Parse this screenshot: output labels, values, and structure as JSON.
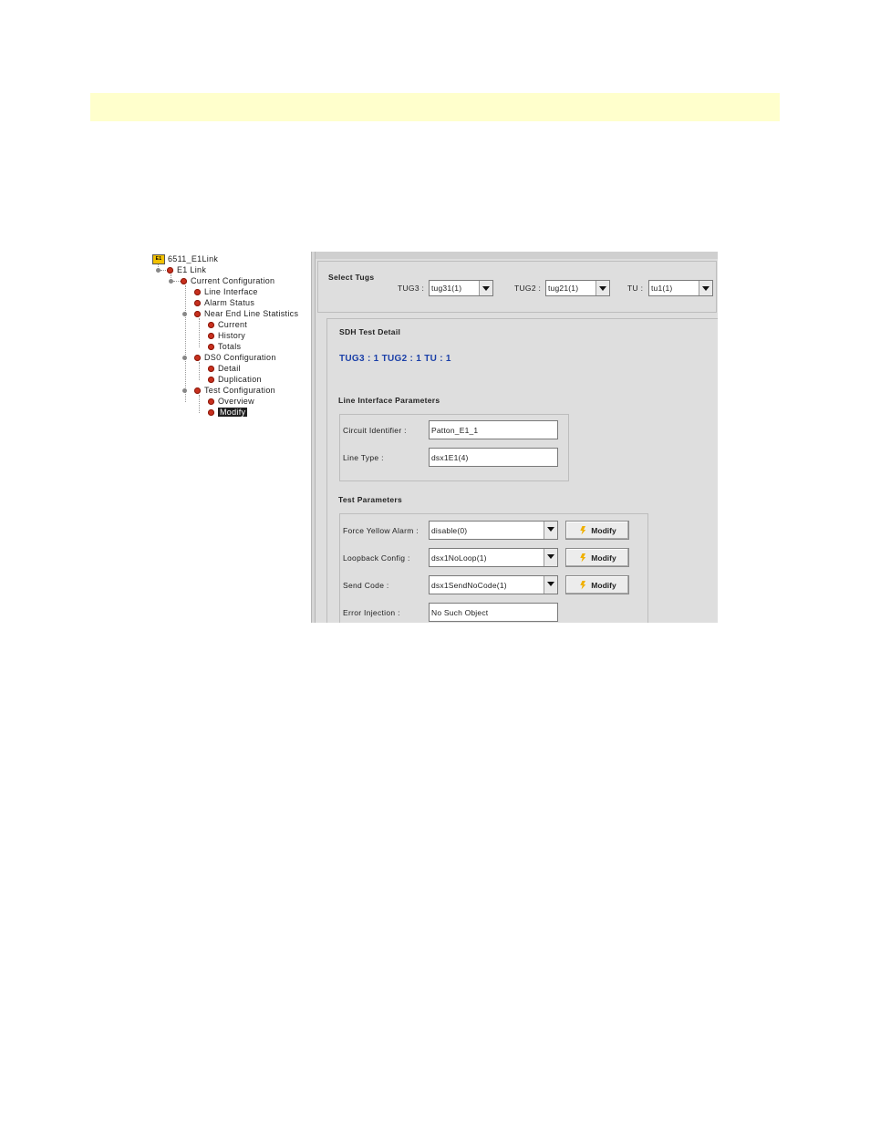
{
  "tree": {
    "root": "6511_E1Link",
    "root_badge": "E1",
    "nodes": [
      "E1 Link",
      "Current Configuration",
      "Line Interface",
      "Alarm Status",
      "Near End Line Statistics",
      "Current",
      "History",
      "Totals",
      "DS0 Configuration",
      "Detail",
      "Duplication",
      "Test Configuration",
      "Overview",
      "Modify"
    ]
  },
  "select_tugs": {
    "title": "Select Tugs",
    "tug3_label": "TUG3 :",
    "tug3_value": "tug31(1)",
    "tug2_label": "TUG2 :",
    "tug2_value": "tug21(1)",
    "tu_label": "TU :",
    "tu_value": "tu1(1)"
  },
  "detail": {
    "title": "SDH Test Detail",
    "path": "TUG3 : 1 TUG2 : 1 TU : 1",
    "line_section": "Line Interface Parameters",
    "circuit_label": "Circuit Identifier :",
    "circuit_value": "Patton_E1_1",
    "linetype_label": "Line Type :",
    "linetype_value": "dsx1E1(4)",
    "test_section": "Test Parameters",
    "yellow_label": "Force Yellow Alarm :",
    "yellow_value": "disable(0)",
    "loop_label": "Loopback Config :",
    "loop_value": "dsx1NoLoop(1)",
    "send_label": "Send Code :",
    "send_value": "dsx1SendNoCode(1)",
    "error_label": "Error Injection :",
    "error_value": "No Such Object",
    "modify_label": "Modify"
  }
}
